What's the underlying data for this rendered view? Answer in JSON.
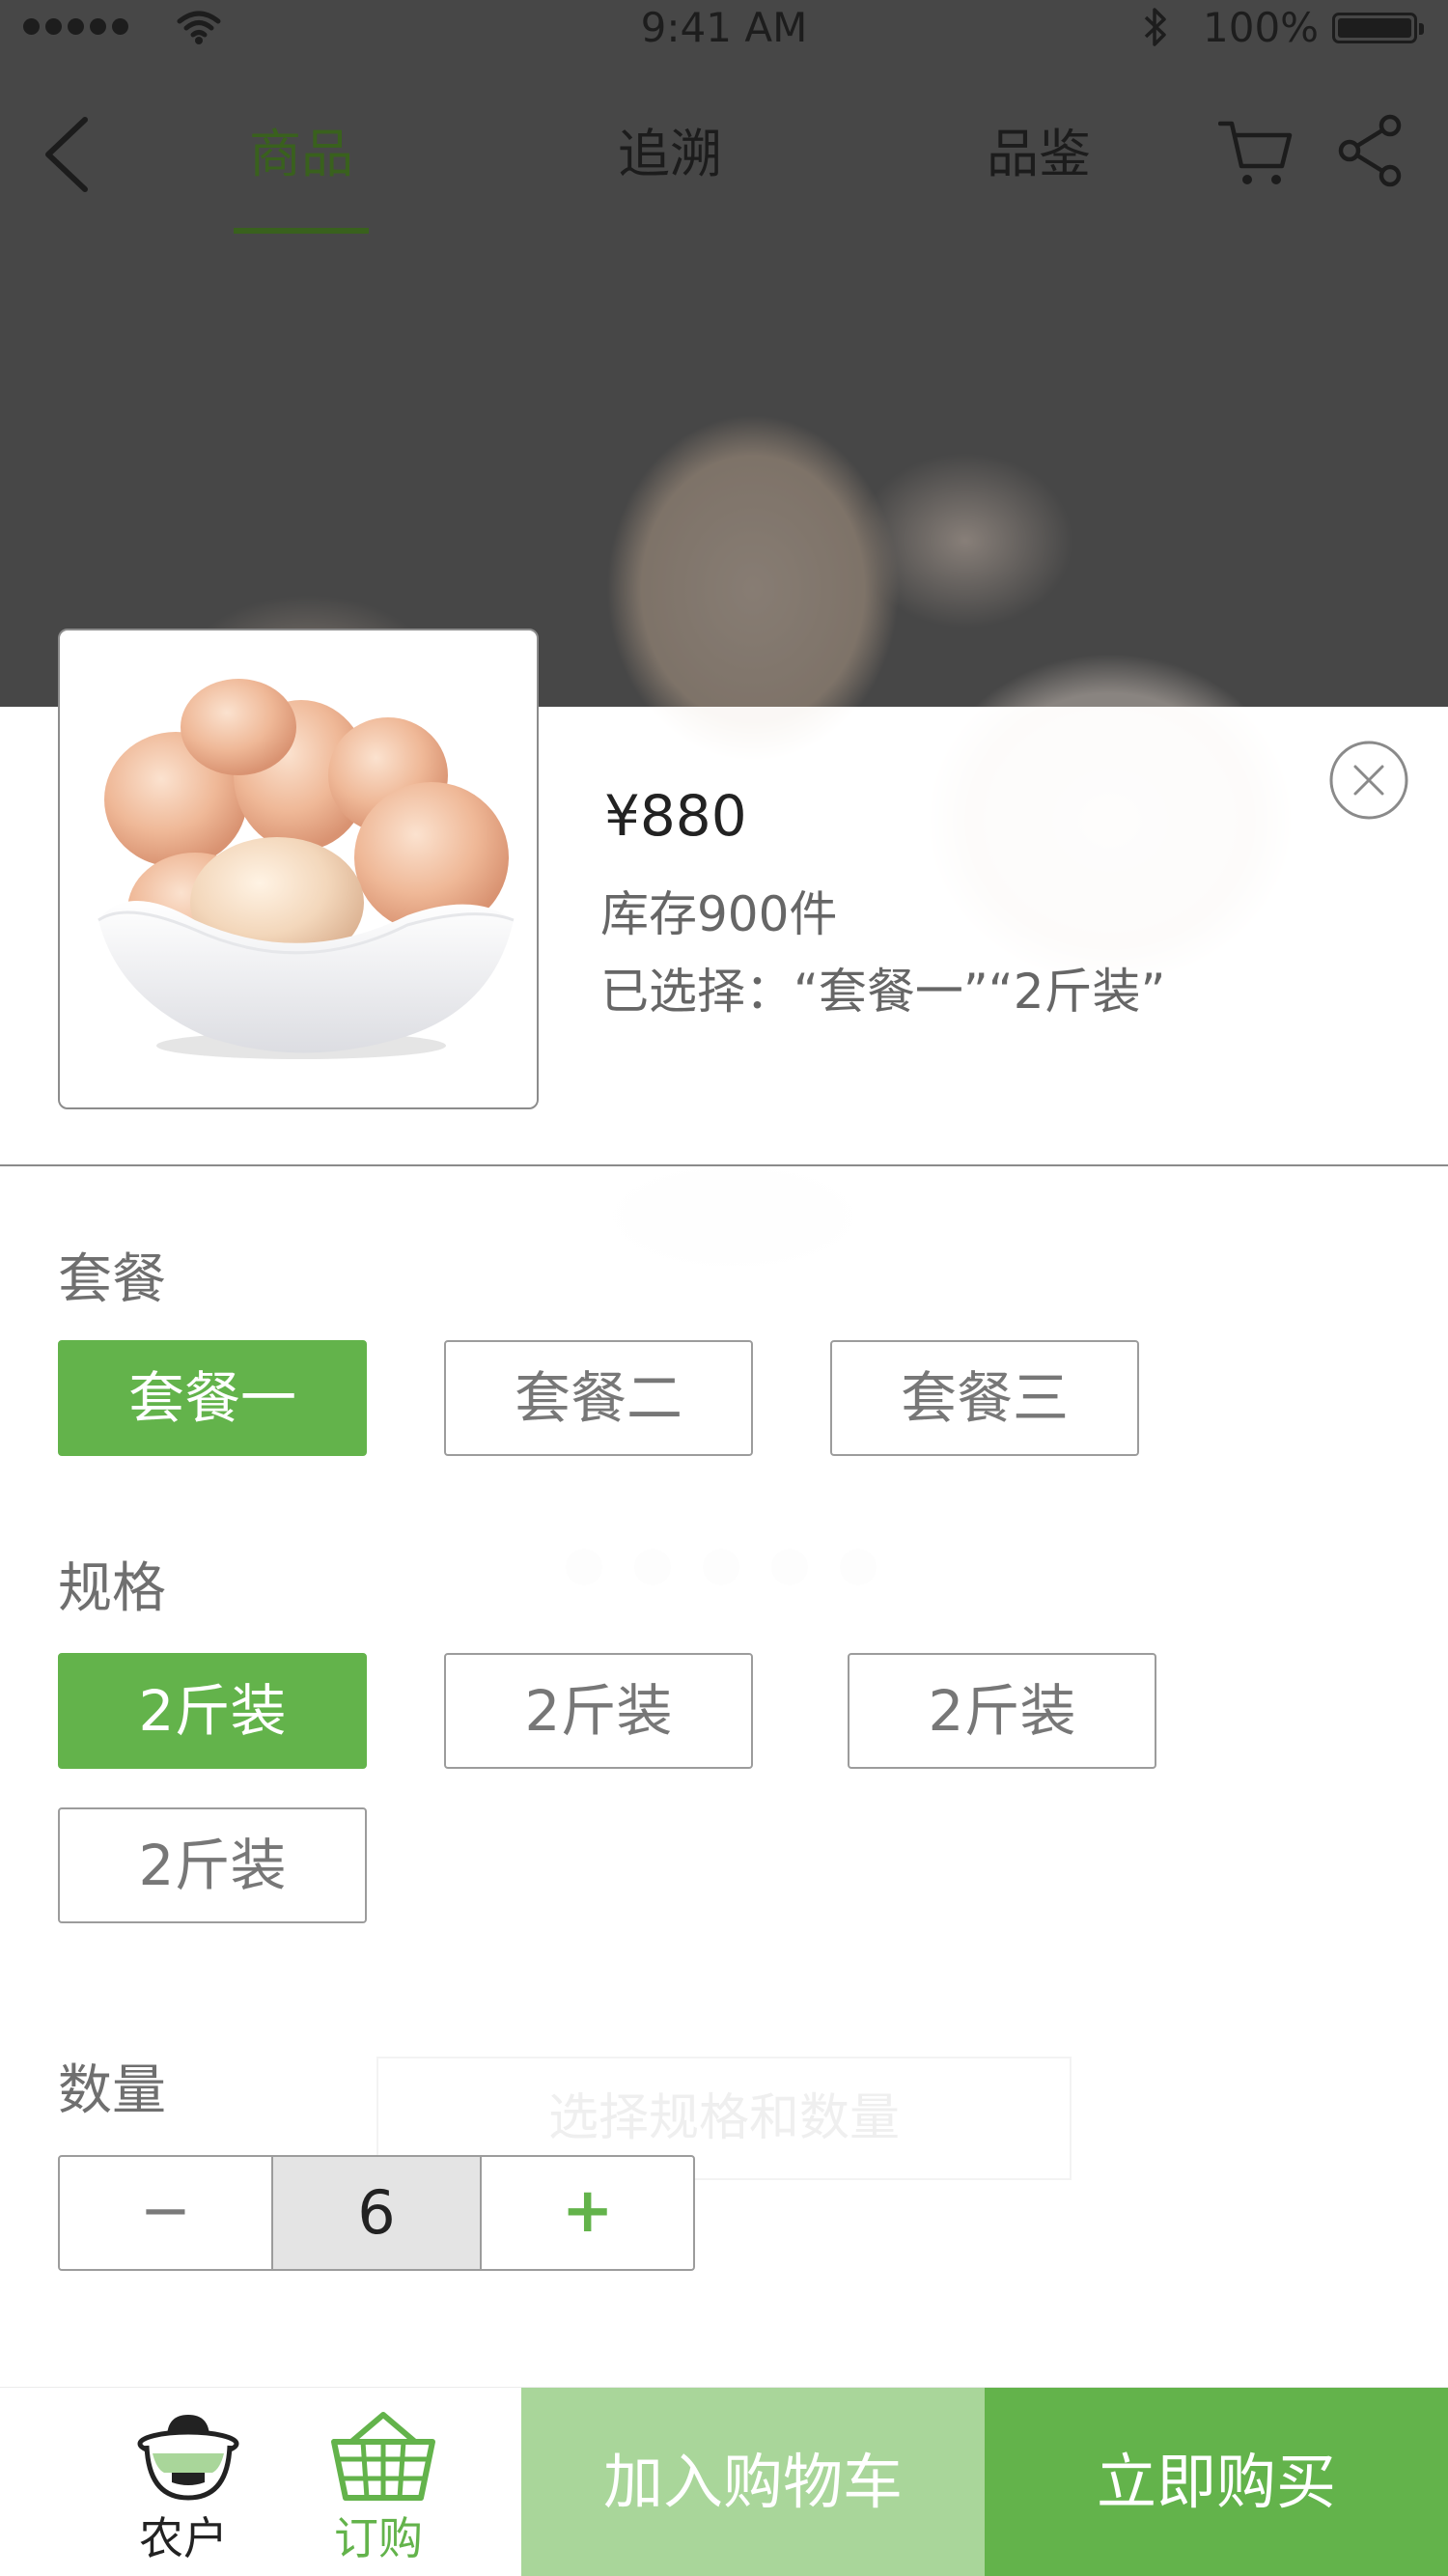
{
  "status_bar": {
    "time": "9:41 AM",
    "battery": "100%"
  },
  "nav": {
    "back_icon": "chevron-left-icon",
    "tabs": [
      {
        "label": "商品",
        "active": true
      },
      {
        "label": "追溯",
        "active": false
      },
      {
        "label": "品鉴",
        "active": false
      }
    ],
    "cart_icon": "cart-icon",
    "share_icon": "share-icon"
  },
  "background": {
    "action_hint": "选择规格和数量",
    "carousel_dots": 5
  },
  "sheet": {
    "price": "¥880",
    "stock": "库存900件",
    "selected": "已选择：“套餐一”“2斤装”",
    "package_label": "套餐",
    "packages": [
      {
        "label": "套餐一",
        "selected": true
      },
      {
        "label": "套餐二",
        "selected": false
      },
      {
        "label": "套餐三",
        "selected": false
      }
    ],
    "spec_label": "规格",
    "specs": [
      {
        "label": "2斤装",
        "selected": true
      },
      {
        "label": "2斤装",
        "selected": false
      },
      {
        "label": "2斤装",
        "selected": false
      },
      {
        "label": "2斤装",
        "selected": false
      }
    ],
    "quantity_label": "数量",
    "quantity": {
      "minus": "−",
      "value": "6",
      "plus": "+"
    }
  },
  "bottom_bar": {
    "farmer_label": "农户",
    "order_label": "订购",
    "add_to_cart": "加入购物车",
    "buy_now": "立即购买"
  },
  "colors": {
    "accent": "#63b34b",
    "accent_light": "#a9d69a",
    "active_tab": "#39611d"
  }
}
